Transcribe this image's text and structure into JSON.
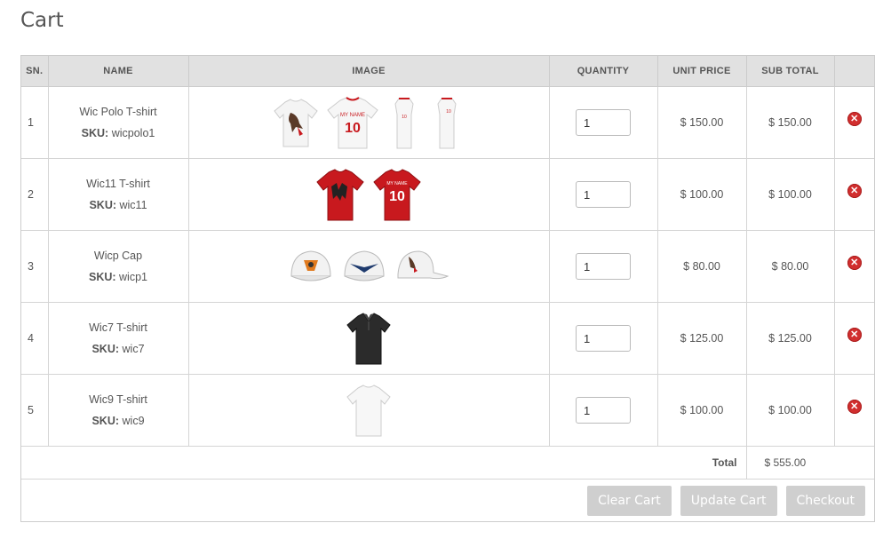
{
  "page": {
    "title": "Cart"
  },
  "table": {
    "headers": {
      "sn": "SN.",
      "name": "NAME",
      "image": "IMAGE",
      "quantity": "QUANTITY",
      "unit_price": "UNIT PRICE",
      "sub_total": "SUB TOTAL"
    },
    "sku_label": "SKU:",
    "rows": [
      {
        "sn": "1",
        "name": "Wic Polo T-shirt",
        "sku": "wicpolo1",
        "quantity": "1",
        "unit_price": "$ 150.00",
        "sub_total": "$ 150.00",
        "images": [
          "white-tshirt-bird-print",
          "white-tshirt-number-10",
          "white-tshirt-side",
          "white-tshirt-side"
        ]
      },
      {
        "sn": "2",
        "name": "Wic11 T-shirt",
        "sku": "wic11",
        "quantity": "1",
        "unit_price": "$ 100.00",
        "sub_total": "$ 100.00",
        "images": [
          "red-tshirt-group-print",
          "red-tshirt-number-10"
        ]
      },
      {
        "sn": "3",
        "name": "Wicp Cap",
        "sku": "wicp1",
        "quantity": "1",
        "unit_price": "$ 80.00",
        "sub_total": "$ 80.00",
        "images": [
          "white-cap-logo",
          "white-cap-eagle",
          "white-cap-side"
        ]
      },
      {
        "sn": "4",
        "name": "Wic7 T-shirt",
        "sku": "wic7",
        "quantity": "1",
        "unit_price": "$ 125.00",
        "sub_total": "$ 125.00",
        "images": [
          "black-polo-shirt"
        ]
      },
      {
        "sn": "5",
        "name": "Wic9 T-shirt",
        "sku": "wic9",
        "quantity": "1",
        "unit_price": "$ 100.00",
        "sub_total": "$ 100.00",
        "images": [
          "plain-white-tshirt"
        ]
      }
    ],
    "total_label": "Total",
    "total_value": "$ 555.00"
  },
  "actions": {
    "clear": "Clear Cart",
    "update": "Update Cart",
    "checkout": "Checkout"
  },
  "colors": {
    "header_bg": "#e1e1e1",
    "remove_icon": "#d12e2e",
    "button_bg": "#cfcfcf",
    "shirt_red": "#c8191e",
    "number_red": "#c8191e"
  },
  "icons": {
    "remove": "remove-icon"
  }
}
